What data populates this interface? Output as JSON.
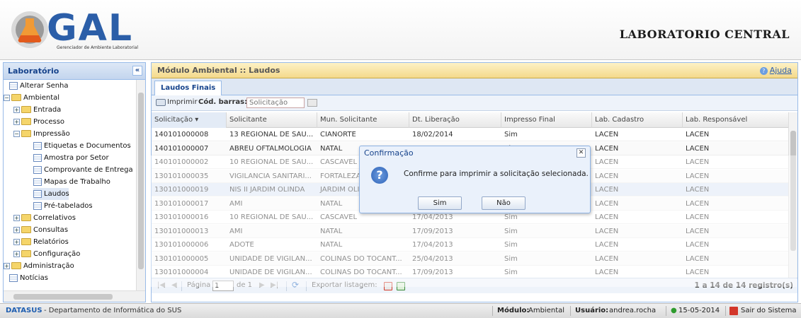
{
  "header": {
    "logo_text": "GAL",
    "logo_subtitle": "Gerenciador de Ambiente Laboratorial",
    "lab_name": "LABORATORIO CENTRAL"
  },
  "sidebar": {
    "title": "Laboratório",
    "items": [
      {
        "label": "Alterar Senha",
        "icon": "document-icon"
      },
      {
        "label": "Ambiental",
        "icon": "folder-open-icon"
      },
      {
        "label": "Entrada",
        "icon": "folder-icon"
      },
      {
        "label": "Processo",
        "icon": "folder-icon"
      },
      {
        "label": "Impressão",
        "icon": "folder-open-icon"
      },
      {
        "label": "Etiquetas e Documentos",
        "icon": "document-icon"
      },
      {
        "label": "Amostra por Setor",
        "icon": "document-icon"
      },
      {
        "label": "Comprovante de Entrega",
        "icon": "document-icon"
      },
      {
        "label": "Mapas de Trabalho",
        "icon": "document-icon"
      },
      {
        "label": "Laudos",
        "icon": "document-icon"
      },
      {
        "label": "Pré-tabelados",
        "icon": "document-icon"
      },
      {
        "label": "Correlativos",
        "icon": "folder-icon"
      },
      {
        "label": "Consultas",
        "icon": "folder-icon"
      },
      {
        "label": "Relatórios",
        "icon": "folder-icon"
      },
      {
        "label": "Configuração",
        "icon": "folder-icon"
      },
      {
        "label": "Administração",
        "icon": "folder-icon"
      },
      {
        "label": "Notícias",
        "icon": "document-icon"
      }
    ]
  },
  "main": {
    "title": "Módulo Ambiental :: Laudos",
    "help_label": "Ajuda",
    "tab_label": "Laudos Finais",
    "toolbar": {
      "print_label": "Imprimir",
      "barcode_label": "Cód. barras:",
      "barcode_placeholder": "Solicitação"
    },
    "columns": [
      "Solicitação",
      "Solicitante",
      "Mun. Solicitante",
      "Dt. Liberação",
      "Impresso Final",
      "Lab. Cadastro",
      "Lab. Responsável"
    ],
    "rows": [
      [
        "140101000008",
        "13 REGIONAL DE SAU...",
        "CIANORTE",
        "18/02/2014",
        "Sim",
        "LACEN",
        "LACEN"
      ],
      [
        "140101000007",
        "ABREU OFTALMOLOGIA",
        "NATAL",
        "14/02/2014",
        "Sim",
        "LACEN",
        "LACEN"
      ],
      [
        "140101000002",
        "10 REGIONAL DE SAU...",
        "CASCAVEL",
        "",
        "",
        "LACEN",
        "LACEN"
      ],
      [
        "130101000035",
        "VIGILANCIA SANITARI...",
        "FORTALEZA",
        "",
        "",
        "LACEN",
        "LACEN"
      ],
      [
        "130101000019",
        "NIS II JARDIM OLINDA",
        "JARDIM OLINDA",
        "",
        "",
        "LACEN",
        "LACEN"
      ],
      [
        "130101000017",
        "AMI",
        "NATAL",
        "17/04/2013",
        "Sim",
        "LACEN",
        "LACEN"
      ],
      [
        "130101000016",
        "10 REGIONAL DE SAU...",
        "CASCAVEL",
        "17/04/2013",
        "Sim",
        "LACEN",
        "LACEN"
      ],
      [
        "130101000013",
        "AMI",
        "NATAL",
        "17/09/2013",
        "Sim",
        "LACEN",
        "LACEN"
      ],
      [
        "130101000006",
        "ADOTE",
        "NATAL",
        "17/04/2013",
        "Sim",
        "LACEN",
        "LACEN"
      ],
      [
        "130101000005",
        "UNIDADE DE VIGILAN...",
        "COLINAS DO TOCANT...",
        "25/04/2013",
        "Sim",
        "LACEN",
        "LACEN"
      ],
      [
        "130101000004",
        "UNIDADE DE VIGILAN...",
        "COLINAS DO TOCANT...",
        "17/09/2013",
        "Sim",
        "LACEN",
        "LACEN"
      ]
    ],
    "pager": {
      "page_label": "Página",
      "page_value": "1",
      "of_label": "de 1",
      "export_label": "Exportar listagem:",
      "summary": "1 a 14 de 14 registro(s)"
    }
  },
  "dialog": {
    "title": "Confirmação",
    "message": "Confirme para imprimir a solicitação selecionada.",
    "yes_label": "Sim",
    "no_label": "Não"
  },
  "footer": {
    "org": "DATASUS",
    "org_desc": "- Departamento de Informática do SUS",
    "module_label": "Módulo:",
    "module_value": "Ambiental",
    "user_label": "Usuário:",
    "user_value": "andrea.rocha",
    "date": "15-05-2014",
    "logout": "Sair do Sistema"
  },
  "colors": {
    "accent": "#15428b",
    "header_bar": "#f4d98b",
    "selection": "#dfe8f6",
    "footer_org": "#1f5eb0"
  }
}
